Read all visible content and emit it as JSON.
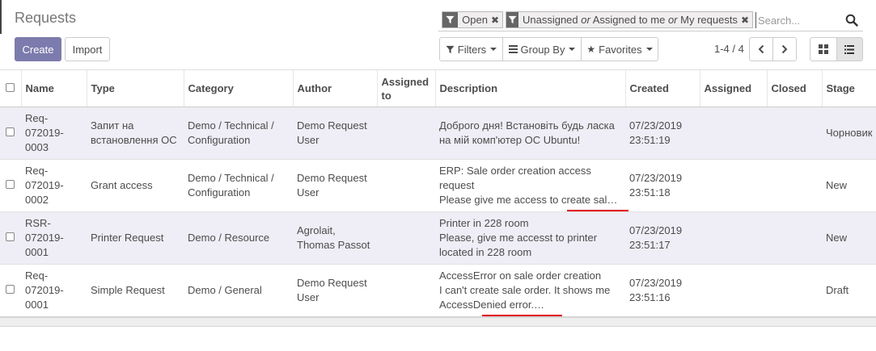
{
  "page": {
    "title": "Requests"
  },
  "buttons": {
    "create": "Create",
    "import": "Import"
  },
  "search": {
    "facets": [
      {
        "icon": "filter-icon",
        "parts": [
          {
            "text": "Open",
            "italic": false
          }
        ]
      },
      {
        "icon": "filter-icon",
        "parts": [
          {
            "text": "Unassigned ",
            "italic": false
          },
          {
            "text": "or",
            "italic": true
          },
          {
            "text": " Assigned to me ",
            "italic": false
          },
          {
            "text": "or",
            "italic": true
          },
          {
            "text": " My requests",
            "italic": false
          }
        ]
      }
    ],
    "placeholder": "Search..."
  },
  "toolbar": {
    "filters": "Filters",
    "group_by": "Group By",
    "favorites": "Favorites"
  },
  "pager": {
    "text": "1-4 / 4"
  },
  "table": {
    "headers": [
      "Name",
      "Type",
      "Category",
      "Author",
      "Assigned to",
      "Description",
      "Created",
      "Assigned",
      "Closed",
      "Stage"
    ],
    "rows": [
      {
        "name": [
          "Req-",
          "072019-",
          "0003"
        ],
        "type": [
          "Запит на",
          "встановлення ОС"
        ],
        "category": [
          "Demo / Technical /",
          "Configuration"
        ],
        "author": [
          "Demo Request",
          "User"
        ],
        "assigned_to": "",
        "description": [
          "Доброго дня! Встановіть будь ласка",
          "на мій комп'ютер ОС Ubuntu!"
        ],
        "created": [
          "07/23/2019",
          "23:51:19"
        ],
        "assigned": "",
        "closed": "",
        "stage": "Чорновик"
      },
      {
        "name": [
          "Req-",
          "072019-",
          "0002"
        ],
        "type": [
          "Grant access"
        ],
        "category": [
          "Demo / Technical /",
          "Configuration"
        ],
        "author": [
          "Demo Request",
          "User"
        ],
        "assigned_to": "",
        "description": [
          "ERP: Sale order creation access",
          "request",
          "Please give me access to create sal…"
        ],
        "created": [
          "07/23/2019",
          "23:51:18"
        ],
        "assigned": "",
        "closed": "",
        "stage": "New"
      },
      {
        "name": [
          "RSR-",
          "072019-",
          "0001"
        ],
        "type": [
          "Printer Request"
        ],
        "category": [
          "Demo / Resource"
        ],
        "author": [
          "Agrolait,",
          "Thomas Passot"
        ],
        "assigned_to": "",
        "description": [
          "Printer in 228 room",
          "Please, give me accesst to printer",
          "located in 228 room"
        ],
        "created": [
          "07/23/2019",
          "23:51:17"
        ],
        "assigned": "",
        "closed": "",
        "stage": "New"
      },
      {
        "name": [
          "Req-",
          "072019-",
          "0001"
        ],
        "type": [
          "Simple Request"
        ],
        "category": [
          "Demo / General"
        ],
        "author": [
          "Demo Request",
          "User"
        ],
        "assigned_to": "",
        "description": [
          "AccessError on sale order creation",
          "I can't create sale order. It shows me",
          "AccessDenied error.…"
        ],
        "created": [
          "07/23/2019",
          "23:51:16"
        ],
        "assigned": "",
        "closed": "",
        "stage": "Draft"
      }
    ]
  },
  "colors": {
    "primary": "#7c7bad",
    "row_tint": "#efedf5",
    "annotation": "#e0000b"
  }
}
